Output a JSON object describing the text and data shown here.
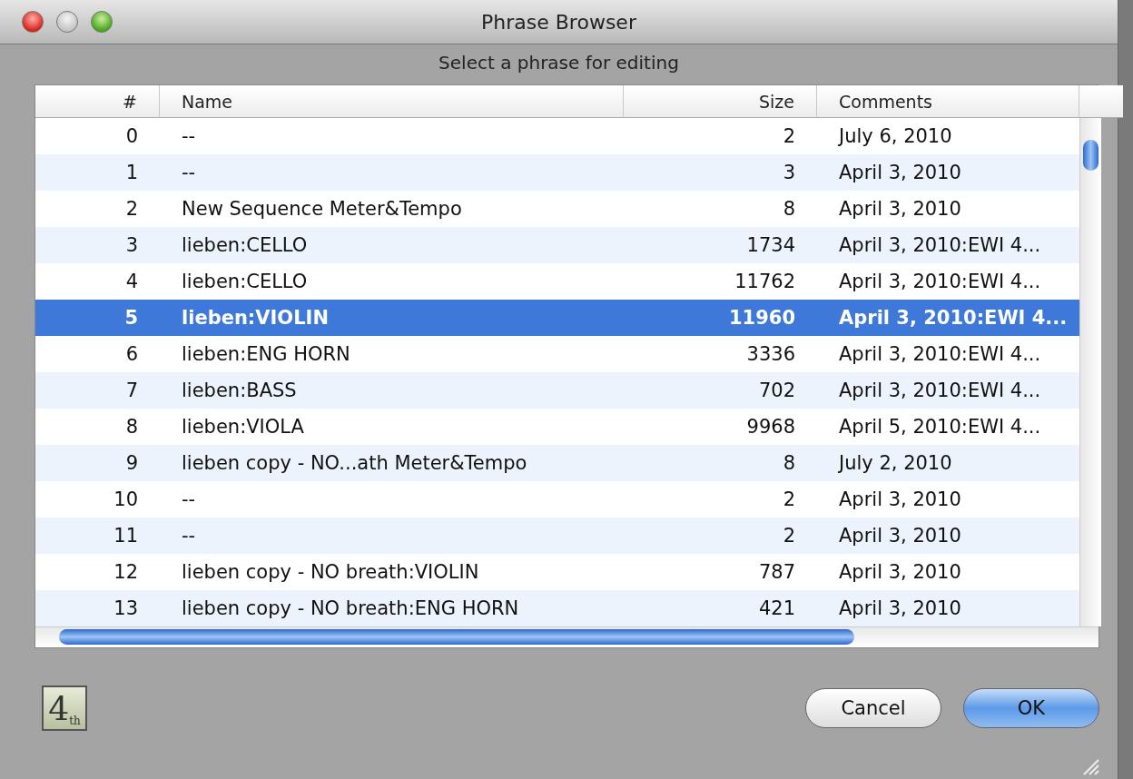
{
  "window": {
    "title": "Phrase Browser",
    "subtitle": "Select a phrase for editing"
  },
  "table": {
    "columns": [
      "#",
      "Name",
      "Size",
      "Comments"
    ],
    "rows": [
      {
        "cells": [
          "0",
          "--",
          "2",
          "July 6, 2010"
        ],
        "selected": false
      },
      {
        "cells": [
          "1",
          "--",
          "3",
          "April 3, 2010"
        ],
        "selected": false
      },
      {
        "cells": [
          "2",
          "New Sequence Meter&Tempo",
          "8",
          "April 3, 2010"
        ],
        "selected": false
      },
      {
        "cells": [
          "3",
          "lieben:CELLO",
          "1734",
          "April 3, 2010:EWI 4..."
        ],
        "selected": false
      },
      {
        "cells": [
          "4",
          "lieben:CELLO",
          "11762",
          "April 3, 2010:EWI 4..."
        ],
        "selected": false
      },
      {
        "cells": [
          "5",
          "lieben:VIOLIN",
          "11960",
          "April 3, 2010:EWI 4..."
        ],
        "selected": true
      },
      {
        "cells": [
          "6",
          "lieben:ENG HORN",
          "3336",
          "April 3, 2010:EWI 4..."
        ],
        "selected": false
      },
      {
        "cells": [
          "7",
          "lieben:BASS",
          "702",
          "April 3, 2010:EWI 4..."
        ],
        "selected": false
      },
      {
        "cells": [
          "8",
          "lieben:VIOLA",
          "9968",
          "April 5, 2010:EWI 4..."
        ],
        "selected": false
      },
      {
        "cells": [
          "9",
          "lieben copy - NO...ath Meter&Tempo",
          "8",
          "July 2, 2010"
        ],
        "selected": false
      },
      {
        "cells": [
          "10",
          "--",
          "2",
          "April 3, 2010"
        ],
        "selected": false
      },
      {
        "cells": [
          "11",
          "--",
          "2",
          "April 3, 2010"
        ],
        "selected": false
      },
      {
        "cells": [
          "12",
          "lieben copy - NO breath:VIOLIN",
          "787",
          "April 3, 2010"
        ],
        "selected": false
      },
      {
        "cells": [
          "13",
          "lieben copy - NO breath:ENG HORN",
          "421",
          "April 3, 2010"
        ],
        "selected": false
      }
    ]
  },
  "footer": {
    "logo": {
      "main": "4",
      "sub": "th"
    },
    "buttons": [
      {
        "label": "Cancel",
        "default": false
      },
      {
        "label": "OK",
        "default": true
      }
    ]
  }
}
